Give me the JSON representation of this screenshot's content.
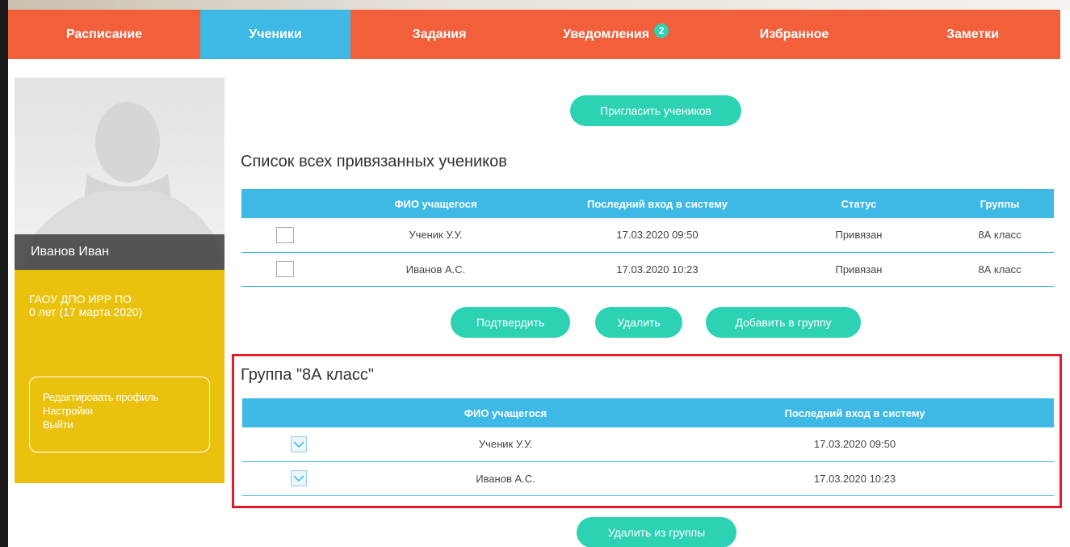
{
  "nav": {
    "items": [
      {
        "label": "Расписание",
        "active": false
      },
      {
        "label": "Ученики",
        "active": true
      },
      {
        "label": "Задания",
        "active": false
      },
      {
        "label": "Уведомления",
        "active": false,
        "badge": "2"
      },
      {
        "label": "Избранное",
        "active": false
      },
      {
        "label": "Заметки",
        "active": false
      }
    ]
  },
  "sidebar": {
    "user_name": "Иванов Иван",
    "org_line1": "ГАОУ ДПО ИРР ПО",
    "org_line2": "0 лет (17 марта 2020)",
    "menu": [
      "Редактировать профиль",
      "Настройки",
      "Выйти"
    ]
  },
  "main": {
    "invite_button": "Пригласить учеников",
    "all_students_title": "Список всех привязанных учеников",
    "all_table": {
      "headers": [
        "",
        "ФИО учащегося",
        "Последний вход в систему",
        "Статус",
        "Группы"
      ],
      "rows": [
        {
          "checked": false,
          "name": "Ученик У.У.",
          "last_login": "17.03.2020 09:50",
          "status": "Привязан",
          "group": "8А класс"
        },
        {
          "checked": false,
          "name": "Иванов А.С.",
          "last_login": "17.03.2020 10:23",
          "status": "Привязан",
          "group": "8А класс"
        }
      ]
    },
    "actions": {
      "confirm": "Подтвердить",
      "delete": "Удалить",
      "add_to_group": "Добавить в группу"
    },
    "group_title": "Группа \"8А класс\"",
    "group_table": {
      "headers": [
        "",
        "ФИО учащегося",
        "Последний вход в систему"
      ],
      "rows": [
        {
          "checked": true,
          "name": "Ученик У.У.",
          "last_login": "17.03.2020 09:50"
        },
        {
          "checked": true,
          "name": "Иванов А.С.",
          "last_login": "17.03.2020 10:23"
        }
      ]
    },
    "remove_from_group": "Удалить из группы"
  },
  "colors": {
    "nav_bg": "#f15f3b",
    "nav_active": "#3eb8e4",
    "accent_button": "#2dd1b4",
    "sidebar_info": "#eac20e",
    "highlight_frame": "#e21c2a"
  }
}
